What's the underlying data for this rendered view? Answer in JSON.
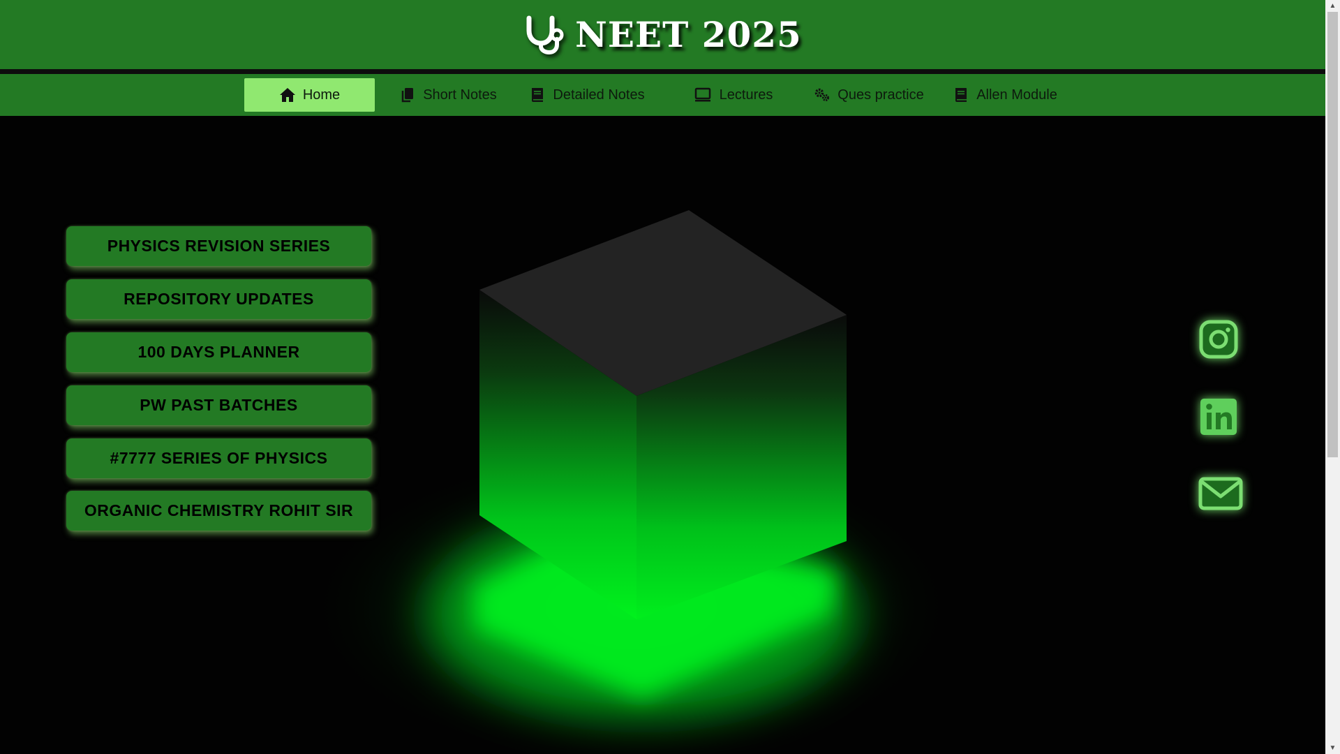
{
  "header": {
    "title": "NEET 2025",
    "icon": "stethoscope-icon"
  },
  "nav": {
    "items": [
      {
        "label": "Home",
        "icon": "home-icon",
        "active": true
      },
      {
        "label": "Short Notes",
        "icon": "copy-icon",
        "active": false
      },
      {
        "label": "Detailed Notes",
        "icon": "book-icon",
        "active": false
      },
      {
        "label": "Lectures",
        "icon": "monitor-icon",
        "active": false
      },
      {
        "label": "Ques practice",
        "icon": "gears-icon",
        "active": false
      },
      {
        "label": "Allen Module",
        "icon": "book-icon",
        "active": false
      }
    ]
  },
  "sidebar": {
    "buttons": [
      {
        "label": "PHYSICS REVISION SERIES"
      },
      {
        "label": "REPOSITORY UPDATES"
      },
      {
        "label": "100 DAYS PLANNER"
      },
      {
        "label": "PW PAST BATCHES"
      },
      {
        "label": "#7777 SERIES OF PHYSICS"
      },
      {
        "label": "ORGANIC CHEMISTRY ROHIT SIR"
      }
    ]
  },
  "social": {
    "items": [
      {
        "icon": "instagram-icon"
      },
      {
        "icon": "linkedin-icon"
      },
      {
        "icon": "mail-icon"
      }
    ]
  },
  "colors": {
    "header_green": "#237a24",
    "active_tab": "#90e870",
    "glow_green": "#00ff1e",
    "background": "#020202"
  }
}
